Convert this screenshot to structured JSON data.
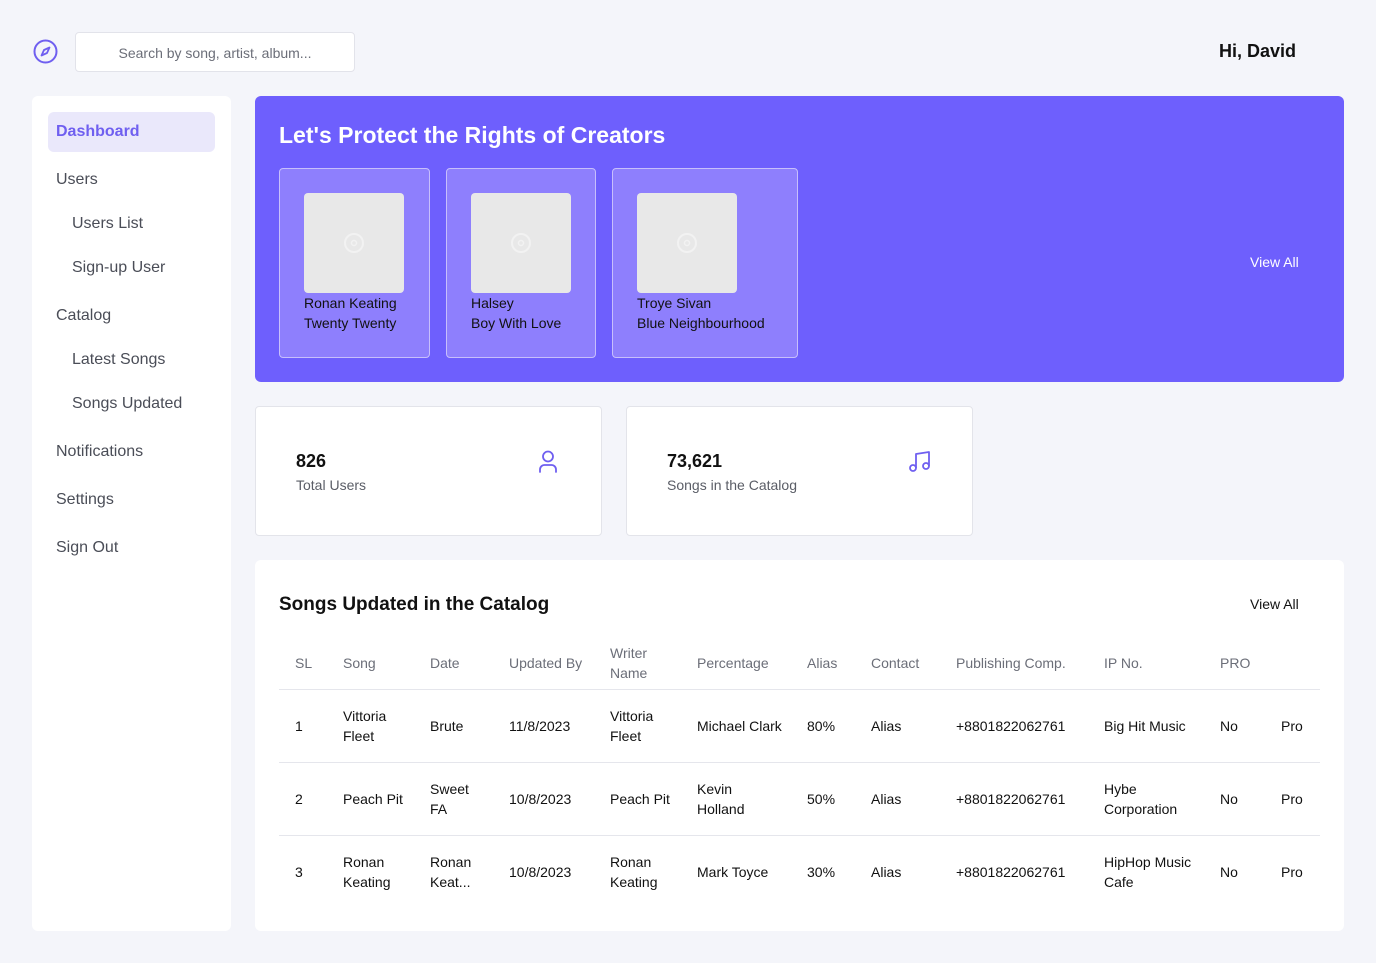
{
  "header": {
    "search_placeholder": "Search by song, artist, album...",
    "greeting": "Hi, David"
  },
  "sidebar": {
    "items": [
      {
        "label": "Dashboard",
        "active": true
      },
      {
        "label": "Users"
      },
      {
        "label": "Users List"
      },
      {
        "label": "Sign-up User"
      },
      {
        "label": "Catalog"
      },
      {
        "label": "Latest Songs"
      },
      {
        "label": "Songs Updated"
      },
      {
        "label": "Notifications"
      },
      {
        "label": "Settings"
      },
      {
        "label": "Sign Out"
      }
    ]
  },
  "banner": {
    "title": "Let's Protect the Rights of Creators",
    "view_all": "View All",
    "songs": [
      {
        "artist": "Ronan Keating",
        "title": "Twenty Twenty"
      },
      {
        "artist": "Halsey",
        "title": "Boy With Love"
      },
      {
        "artist": "Troye Sivan",
        "title": "Blue Neighbourhood"
      }
    ]
  },
  "stats": [
    {
      "value": "826",
      "label": "Total Users",
      "icon": "user-icon"
    },
    {
      "value": "73,621",
      "label": "Songs in the Catalog",
      "icon": "music-note-icon"
    }
  ],
  "table": {
    "title": "Songs Updated in the Catalog",
    "view_all": "View All",
    "columns": [
      "SL",
      "Song",
      "Date",
      "Updated By",
      "Writer Name",
      "Percentage",
      "Alias",
      "Contact",
      "Publishing Comp.",
      "IP No.",
      "PRO"
    ],
    "rows": [
      [
        "1",
        "Vittoria Fleet",
        "Brute",
        "11/8/2023",
        "Vittoria Fleet",
        "Michael Clark",
        "80%",
        "Alias",
        "+8801822062761",
        "Big Hit Music",
        "No",
        "Pro"
      ],
      [
        "2",
        "Peach Pit",
        "Sweet FA",
        "10/8/2023",
        "Peach Pit",
        "Kevin Holland",
        "50%",
        "Alias",
        "+8801822062761",
        "Hybe Corporation",
        "No",
        "Pro"
      ],
      [
        "3",
        "Ronan Keating",
        "Ronan Keat...",
        "10/8/2023",
        "Ronan Keating",
        "Mark Toyce",
        "30%",
        "Alias",
        "+8801822062761",
        "HipHop Music Cafe",
        "No",
        "Pro"
      ]
    ]
  },
  "colors": {
    "accent": "#6e5ffd",
    "card": "#8e7ffd",
    "background": "#f4f5fa"
  }
}
